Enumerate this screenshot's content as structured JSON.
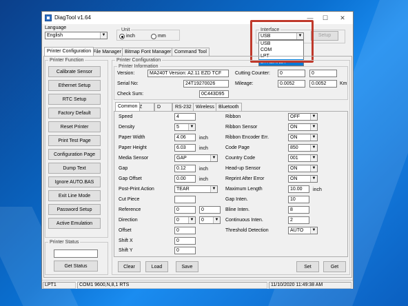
{
  "window": {
    "title": "DiagTool v1.64",
    "minimize": "—",
    "maximize": "☐",
    "close": "✕"
  },
  "language": {
    "caption": "Language",
    "value": "English"
  },
  "unit": {
    "caption": "Unit",
    "inch": "inch",
    "mm": "mm",
    "selected": "inch"
  },
  "interface": {
    "caption": "Interface",
    "value": "USB",
    "options": [
      "USB",
      "COM",
      "LPT",
      "ETHERNET"
    ],
    "highlighted": "ETHERNET",
    "setup": "Setup"
  },
  "tabs": [
    "Printer Configuration",
    "File Manager",
    "Bitmap Font Manager",
    "Command Tool"
  ],
  "printer_function": {
    "caption": "Printer Function",
    "buttons": [
      "Calibrate Sensor",
      "Ethernet Setup",
      "RTC Setup",
      "Factory Default",
      "Reset Printer",
      "Print Test Page",
      "Configuration Page",
      "Dump Text",
      "Ignore AUTO.BAS",
      "Exit Line Mode",
      "Password Setup",
      "Active Emulation"
    ]
  },
  "printer_status": {
    "caption": "Printer Status",
    "get_status": "Get Status"
  },
  "printer_configuration": {
    "caption": "Printer Configuration",
    "info_caption": "Printer Information",
    "version_label": "Version:",
    "version_value": "MA240T Version: A2.11 EZD TCF",
    "serial_label": "Serial No:",
    "serial_value": "24T19270026",
    "checksum_label": "Check Sum:",
    "checksum_value": "0C443D95",
    "cutting_label": "Cutting Counter:",
    "cutting_value1": "0",
    "cutting_value2": "0",
    "mileage_label": "Mileage:",
    "mileage_value1": "0.0052",
    "mileage_value2": "0.0052",
    "mileage_unit": "Km"
  },
  "sub_tabs": [
    "Common",
    "Z",
    "D",
    "RS-232",
    "Wireless",
    "Bluetooth"
  ],
  "common": {
    "speed": {
      "label": "Speed",
      "value": "4"
    },
    "density": {
      "label": "Density",
      "value": "5"
    },
    "paper_width": {
      "label": "Paper Width",
      "value": "4.06",
      "unit": "inch"
    },
    "paper_height": {
      "label": "Paper Height",
      "value": "6.03",
      "unit": "inch"
    },
    "media_sensor": {
      "label": "Media Sensor",
      "value": "GAP"
    },
    "gap": {
      "label": "Gap",
      "value": "0.12",
      "unit": "inch"
    },
    "gap_offset": {
      "label": "Gap Offset",
      "value": "0.00",
      "unit": "inch"
    },
    "post_print": {
      "label": "Post-Print Action",
      "value": "TEAR"
    },
    "cut_piece": {
      "label": "Cut Piece",
      "value": ""
    },
    "reference": {
      "label": "Reference",
      "value1": "0",
      "value2": "0"
    },
    "direction": {
      "label": "Direction",
      "value1": "0",
      "value2": "0"
    },
    "offset": {
      "label": "Offset",
      "value": "0"
    },
    "shift_x": {
      "label": "Shift X",
      "value": "0"
    },
    "shift_y": {
      "label": "Shift Y",
      "value": "0"
    },
    "ribbon": {
      "label": "Ribbon",
      "value": "OFF"
    },
    "ribbon_sensor": {
      "label": "Ribbon Sensor",
      "value": "ON"
    },
    "ribbon_encoder": {
      "label": "Ribbon Encoder Err.",
      "value": "ON"
    },
    "code_page": {
      "label": "Code Page",
      "value": "850"
    },
    "country_code": {
      "label": "Country Code",
      "value": "001"
    },
    "headup_sensor": {
      "label": "Head-up Sensor",
      "value": "ON"
    },
    "reprint": {
      "label": "Reprint After Error",
      "value": "ON"
    },
    "max_length": {
      "label": "Maximum Length",
      "value": "10.00",
      "unit": "inch"
    },
    "gap_inten": {
      "label": "Gap Inten.",
      "value": "10"
    },
    "bline_inten": {
      "label": "Bline Inten.",
      "value": "8"
    },
    "continuous_inten": {
      "label": "Continuous Inten.",
      "value": "2"
    },
    "threshold": {
      "label": "Threshold Detection",
      "value": "AUTO"
    }
  },
  "actions": {
    "clear": "Clear",
    "load": "Load",
    "save": "Save",
    "set": "Set",
    "get": "Get"
  },
  "statusbar": {
    "port": "LPT1",
    "com": "COM1 9600,N,8,1 RTS",
    "datetime": "11/10/2020 11:49:38 AM"
  }
}
